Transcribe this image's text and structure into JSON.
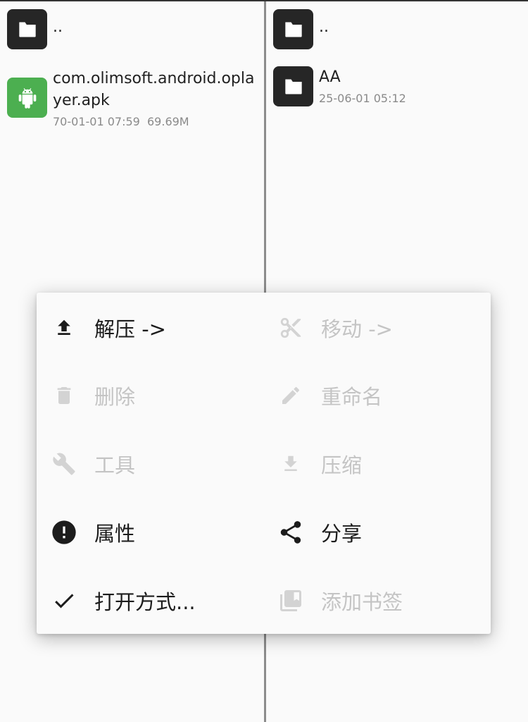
{
  "left_pane": {
    "items": [
      {
        "name": "..",
        "icon": "folder-icon",
        "meta": ""
      },
      {
        "name": "com.olimsoft.android.oplayer.apk",
        "icon": "android-apk-icon",
        "meta": "70-01-01 07:59  69.69M"
      }
    ]
  },
  "right_pane": {
    "items": [
      {
        "name": "..",
        "icon": "folder-icon",
        "meta": ""
      },
      {
        "name": "AA",
        "icon": "folder-icon",
        "meta": "25-06-01 05:12"
      }
    ]
  },
  "menu": {
    "items": [
      {
        "label": "解压 ->",
        "icon": "upload-icon",
        "enabled": true
      },
      {
        "label": "移动 ->",
        "icon": "scissors-icon",
        "enabled": false
      },
      {
        "label": "删除",
        "icon": "trash-icon",
        "enabled": false
      },
      {
        "label": "重命名",
        "icon": "pencil-icon",
        "enabled": false
      },
      {
        "label": "工具",
        "icon": "wrench-icon",
        "enabled": false
      },
      {
        "label": "压缩",
        "icon": "download-icon",
        "enabled": false
      },
      {
        "label": "属性",
        "icon": "info-alert-icon",
        "enabled": true
      },
      {
        "label": "分享",
        "icon": "share-icon",
        "enabled": true
      },
      {
        "label": "打开方式...",
        "icon": "checkmark-icon",
        "enabled": true
      },
      {
        "label": "添加书签",
        "icon": "bookmark-stack-icon",
        "enabled": false
      }
    ]
  },
  "colors": {
    "folder_icon_bg": "#262626",
    "apk_icon_bg": "#4caf50",
    "disabled_text": "#c4c4c4"
  }
}
